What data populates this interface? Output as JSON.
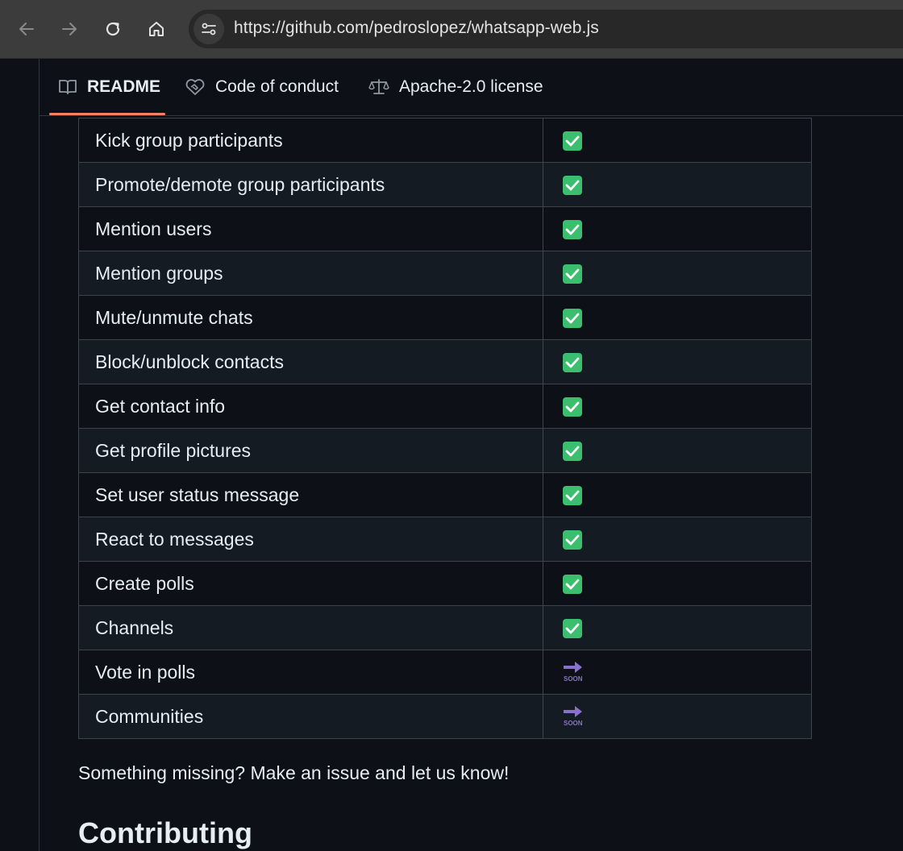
{
  "browser": {
    "url": "https://github.com/pedroslopez/whatsapp-web.js",
    "icons": [
      "back-icon",
      "forward-icon",
      "reload-icon",
      "home-icon",
      "site-info-icon"
    ]
  },
  "tabs": [
    {
      "label": "README",
      "icon": "book-icon",
      "active": true
    },
    {
      "label": "Code of conduct",
      "icon": "heart-handshake-icon",
      "active": false
    },
    {
      "label": "Apache-2.0 license",
      "icon": "scale-icon",
      "active": false
    }
  ],
  "features": [
    {
      "name": "Kick group participants",
      "status": "done"
    },
    {
      "name": "Promote/demote group participants",
      "status": "done"
    },
    {
      "name": "Mention users",
      "status": "done"
    },
    {
      "name": "Mention groups",
      "status": "done"
    },
    {
      "name": "Mute/unmute chats",
      "status": "done"
    },
    {
      "name": "Block/unblock contacts",
      "status": "done"
    },
    {
      "name": "Get contact info",
      "status": "done"
    },
    {
      "name": "Get profile pictures",
      "status": "done"
    },
    {
      "name": "Set user status message",
      "status": "done"
    },
    {
      "name": "React to messages",
      "status": "done"
    },
    {
      "name": "Create polls",
      "status": "done"
    },
    {
      "name": "Channels",
      "status": "done"
    },
    {
      "name": "Vote in polls",
      "status": "soon"
    },
    {
      "name": "Communities",
      "status": "soon"
    }
  ],
  "soon_label": "SOON",
  "missing_text": "Something missing? Make an issue and let us know!",
  "section_heading": "Contributing",
  "colors": {
    "check": "#3bbf6f",
    "soon": "#8a6fd1",
    "tab_underline": "#f78166"
  }
}
